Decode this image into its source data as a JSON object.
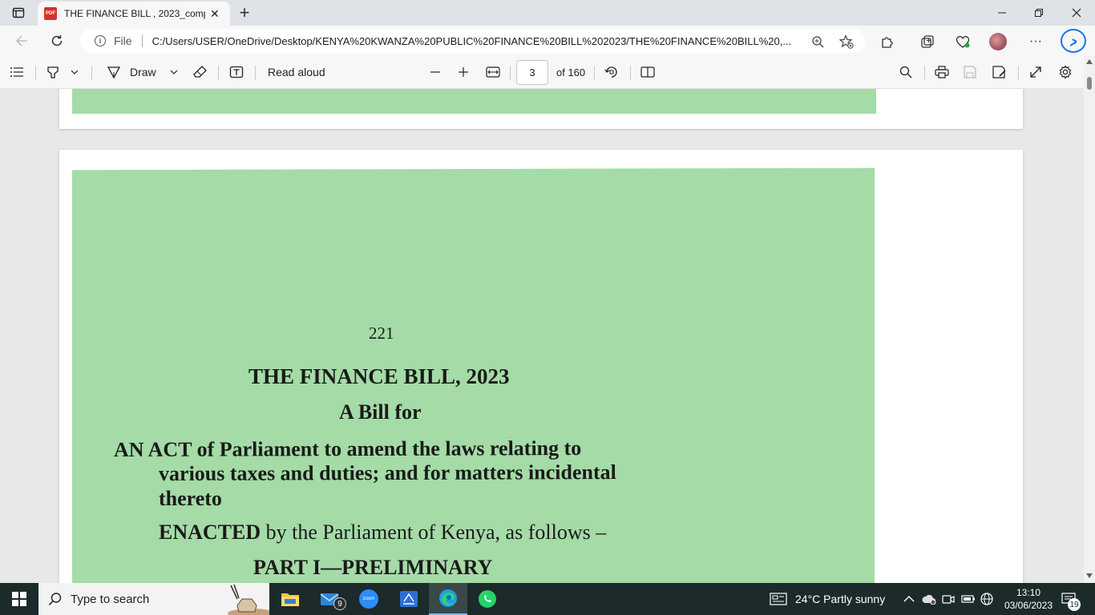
{
  "browser": {
    "tab_title": "THE FINANCE BILL , 2023_compr",
    "tab_close": "✕",
    "new_tab": "+",
    "protocol_label": "File",
    "url": "C:/Users/USER/OneDrive/Desktop/KENYA%20KWANZA%20PUBLIC%20FINANCE%20BILL%202023/THE%20FINANCE%20BILL%20,...",
    "more_menu": "···"
  },
  "pdf_toolbar": {
    "draw_label": "Draw",
    "read_aloud_label": "Read aloud",
    "current_page": "3",
    "page_total": "of 160"
  },
  "document": {
    "page_number": "221",
    "title": "THE FINANCE BILL, 2023",
    "subtitle": "A Bill for",
    "act_line1": "AN ACT of Parliament to amend the laws relating to",
    "act_line2": "various taxes and duties; and for matters incidental",
    "act_line3": "thereto",
    "enacted_bold": "ENACTED",
    "enacted_rest": " by the Parliament of Kenya, as follows –",
    "part_heading": "PART I—PRELIMINARY"
  },
  "taskbar": {
    "search_placeholder": "Type to search",
    "mail_badge": "9",
    "zoom_label": "zoom",
    "weather": "24°C  Partly sunny",
    "time": "13:10",
    "date": "03/06/2023",
    "notification_count": "19"
  },
  "colors": {
    "scan_green": "#a4dba6",
    "taskbar_bg": "#1c2a2a",
    "pdf_icon_red": "#d6332b"
  }
}
